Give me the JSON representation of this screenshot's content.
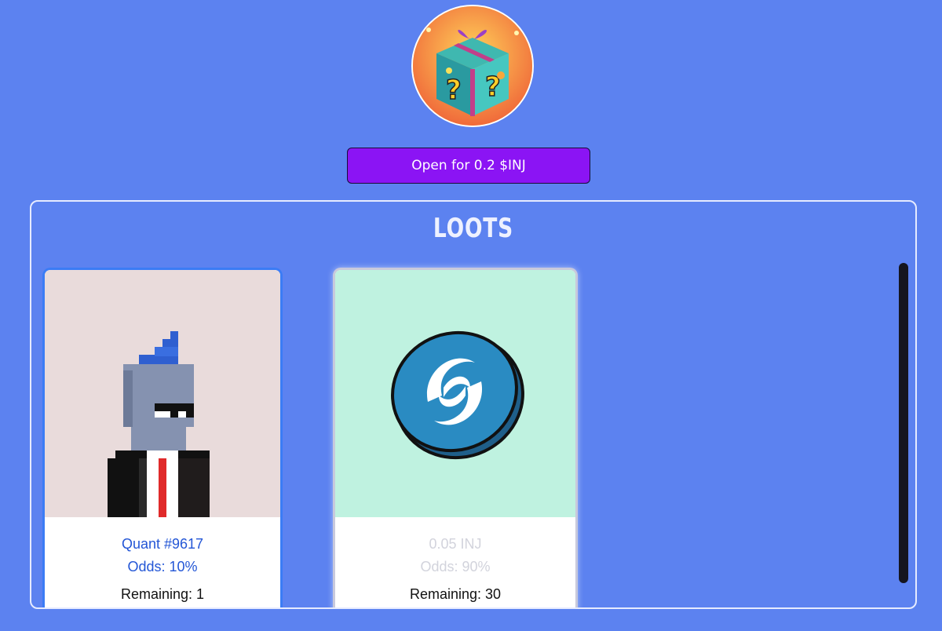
{
  "header": {
    "avatar_icon": "mystery-gift-box-icon",
    "open_button_label": "Open for 0.2 $INJ"
  },
  "loots": {
    "title": "LOOTS",
    "items": [
      {
        "name": "Quant #9617",
        "odds": "Odds: 10%",
        "remaining": "Remaining: 1",
        "image_icon": "pixel-punk-nft-icon"
      },
      {
        "name": "0.05 INJ",
        "odds": "Odds: 90%",
        "remaining": "Remaining: 30",
        "image_icon": "injective-coin-icon"
      }
    ]
  },
  "colors": {
    "background": "#5c82f0",
    "button": "#8b14f4",
    "card1_accent": "#3b7cf5"
  }
}
